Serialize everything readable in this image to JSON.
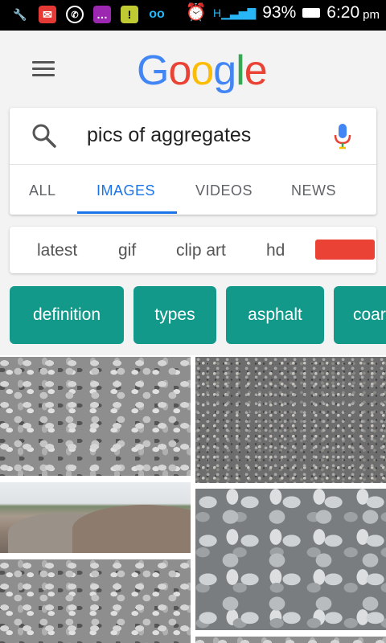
{
  "status_bar": {
    "battery": "93%",
    "time": "6:20",
    "ampm": "pm",
    "network": "H",
    "icons_left": [
      "wrench-icon",
      "app-icon",
      "whatsapp-icon",
      "chat-icon",
      "warning-icon",
      "voicemail-icon"
    ]
  },
  "header": {
    "logo": [
      "G",
      "o",
      "o",
      "g",
      "l",
      "e"
    ]
  },
  "search": {
    "query": "pics of aggregates"
  },
  "tabs": [
    {
      "label": "ALL",
      "active": false
    },
    {
      "label": "IMAGES",
      "active": true
    },
    {
      "label": "VIDEOS",
      "active": false
    },
    {
      "label": "NEWS",
      "active": false
    }
  ],
  "refine": {
    "items": [
      "latest",
      "gif",
      "clip art",
      "hd"
    ],
    "color_swatch": "#ea4335"
  },
  "chips": [
    "definition",
    "types",
    "asphalt",
    "coar"
  ],
  "colors": {
    "accent": "#1a73e8",
    "chip": "#12998a"
  }
}
